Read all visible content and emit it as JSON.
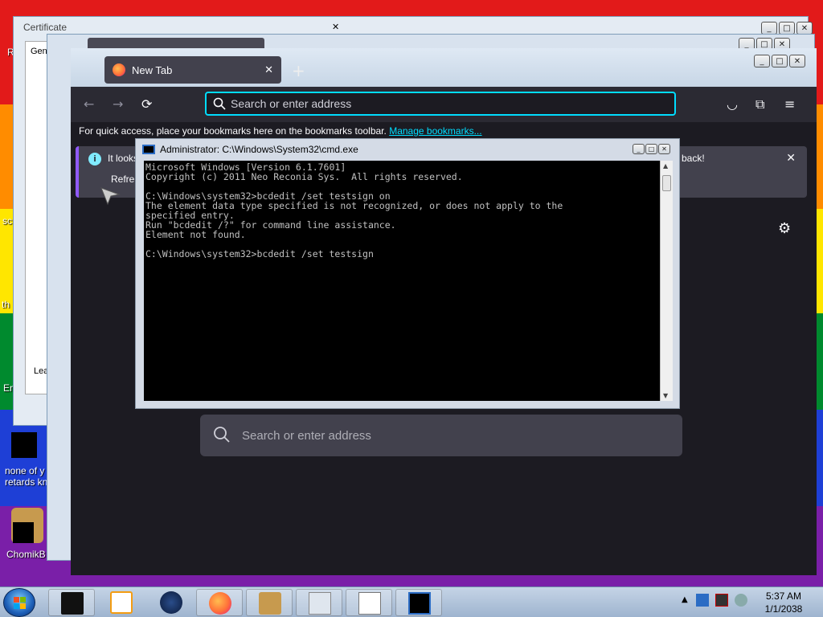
{
  "desktop": {
    "icons": [
      {
        "label": "none of y\nretards kn"
      },
      {
        "label": "ChomikB"
      }
    ],
    "side_labels": [
      "R",
      "sc",
      "th",
      "En"
    ]
  },
  "certificate_window": {
    "title": "Certificate",
    "tab": "Gen",
    "footer_text": "Lea"
  },
  "firefox": {
    "tab_title": "New Tab",
    "url_placeholder": "Search or enter address",
    "bookmarks_prompt": "For quick access, place your bookmarks here on the bookmarks toolbar.",
    "bookmarks_link": "Manage bookmarks...",
    "info_text_start": "It looks",
    "info_text_end": "back!",
    "refresh_label": "Refre",
    "home_search_placeholder": "Search or enter address"
  },
  "cmd": {
    "title": "Administrator: C:\\Windows\\System32\\cmd.exe",
    "lines": [
      "Microsoft Windows [Version 6.1.7601]",
      "Copyright (c) 2011 Neo Reconia Sys.  All rights reserved.",
      "",
      "C:\\Windows\\system32>bcdedit /set testsign on",
      "The element data type specified is not recognized, or does not apply to the",
      "specified entry.",
      "Run \"bcdedit /?\" for command line assistance.",
      "Element not found.",
      "",
      "C:\\Windows\\system32>bcdedit /set testsign"
    ]
  },
  "taskbar": {
    "time": "5:37 AM",
    "date": "1/1/2038"
  },
  "colors": {
    "firefox_bg": "#1c1b22",
    "firefox_accent": "#00ddff",
    "cmd_text": "#c0c0c0"
  }
}
